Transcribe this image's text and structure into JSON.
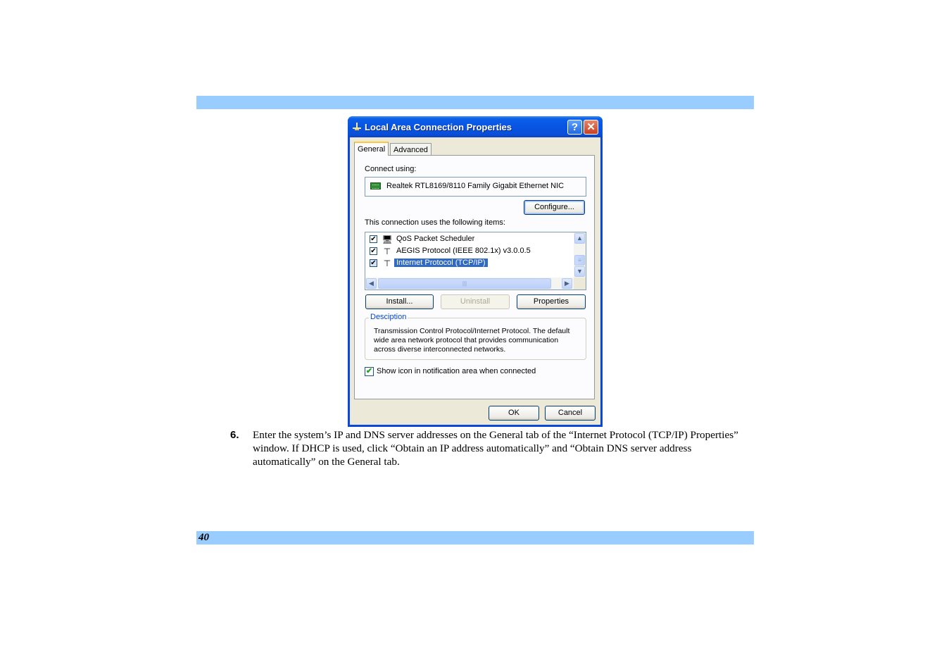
{
  "page": {
    "page_number": "40",
    "band_color": "#99ccff"
  },
  "dialog": {
    "title": "Local Area Connection Properties",
    "title_icon": "network-connection-icon",
    "help_button": "?",
    "close_button": "✕",
    "tabs": [
      {
        "label": "General",
        "active": true
      },
      {
        "label": "Advanced",
        "active": false
      }
    ],
    "connect_using_label": "Connect using:",
    "adapter_name": "Realtek RTL8169/8110 Family Gigabit Ethernet NIC",
    "configure_button": "Configure...",
    "items_label": "This connection uses the following items:",
    "items": [
      {
        "label": "QoS Packet Scheduler",
        "checked": true,
        "icon": "computer-icon",
        "selected": false
      },
      {
        "label": "AEGIS Protocol (IEEE 802.1x) v3.0.0.5",
        "checked": true,
        "icon": "protocol-icon",
        "selected": false
      },
      {
        "label": "Internet Protocol (TCP/IP)",
        "checked": true,
        "icon": "protocol-icon",
        "selected": true
      }
    ],
    "install_button": "Install...",
    "uninstall_button": "Uninstall",
    "properties_button": "Properties",
    "description_title": "Desciption",
    "description_text": "Transmission Control Protocol/Internet Protocol. The default wide area network protocol that provides communication across diverse interconnected networks.",
    "show_icon_label": "Show icon in notification area when connected",
    "show_icon_checked": true,
    "ok_button": "OK",
    "cancel_button": "Cancel",
    "accent_color": "#0a48d8",
    "selection_color": "#316ac5"
  },
  "instruction": {
    "step_number": "6.",
    "text": "Enter the system’s IP and DNS server addresses on the General tab of the “Internet Protocol (TCP/IP) Properties” window.  If DHCP is used, click “Obtain an IP address automatically” and “Obtain DNS server address automatically” on the General tab."
  }
}
